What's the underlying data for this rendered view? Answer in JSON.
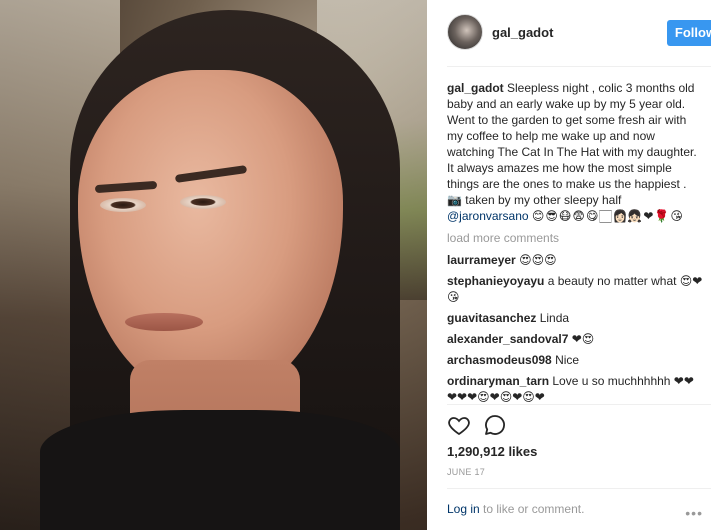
{
  "post": {
    "author": "gal_gadot",
    "follow_label": "Follow",
    "caption_user": "gal_gadot",
    "caption_text": "Sleepless night , colic 3 months old baby and an early wake up by my 5 year old. Went to the garden to get some fresh air with my coffee to help me wake up and now watching The Cat In The Hat with my daughter. It always amazes me how the most simple things are the ones to make us the happiest . 📷 taken by my other sleepy half",
    "caption_mention": "@jaronvarsano",
    "caption_emoji": "😊😎😷😨😋🏻👩🏻‍👧🏻❤🌹😘",
    "load_more": "load more comments",
    "comments": [
      {
        "user": "laurrameyer",
        "text": "😍😍😍"
      },
      {
        "user": "stephanieyoyayu",
        "text": "a beauty no matter what 😍❤😘"
      },
      {
        "user": "guavitasanchez",
        "text": "Linda"
      },
      {
        "user": "alexander_sandoval7",
        "text": "❤😍"
      },
      {
        "user": "archasmodeus098",
        "text": "Nice"
      },
      {
        "user": "ordinaryman_tarn",
        "text": "Love u so muchhhhhh ❤❤❤❤❤😍❤😍❤😍❤"
      }
    ],
    "likes": "1,290,912 likes",
    "date": "JUNE 17",
    "login_link": "Log in",
    "login_suffix": " to like or comment.",
    "more_label": "•••"
  },
  "icons": [
    "heart-icon",
    "comment-icon",
    "more-options-icon"
  ],
  "colors": {
    "follow_button": "#3897f0",
    "mention": "#003569",
    "muted": "#999999"
  }
}
